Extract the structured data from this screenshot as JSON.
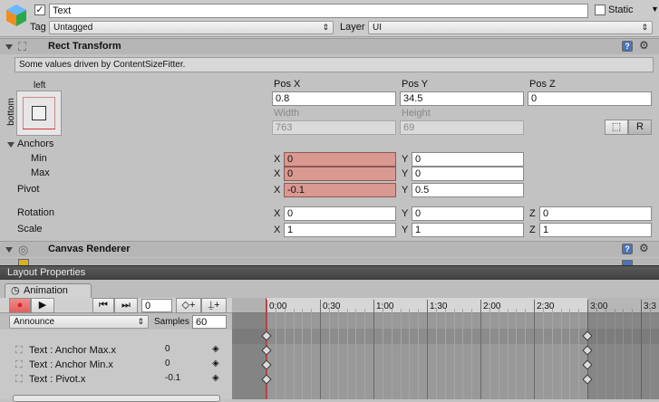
{
  "object": {
    "name": "Text",
    "active": true,
    "static_label": "Static",
    "static_checked": false,
    "tag_label": "Tag",
    "tag_value": "Untagged",
    "layer_label": "Layer",
    "layer_value": "UI"
  },
  "rect_transform": {
    "title": "Rect Transform",
    "info": "Some values driven by ContentSizeFitter.",
    "anchor_preset_top": "left",
    "anchor_preset_side": "bottom",
    "col_headers": [
      "Pos X",
      "Pos Y",
      "Pos Z"
    ],
    "pos_x": "0.8",
    "pos_y": "34.5",
    "pos_z": "0",
    "width_label": "Width",
    "height_label": "Height",
    "width": "763",
    "height": "69",
    "blueprint_r": "R",
    "anchors_label": "Anchors",
    "min_label": "Min",
    "max_label": "Max",
    "pivot_label": "Pivot",
    "rotation_label": "Rotation",
    "scale_label": "Scale",
    "x_label": "X",
    "y_label": "Y",
    "z_label": "Z",
    "anchor_min": {
      "x": "0",
      "y": "0"
    },
    "anchor_max": {
      "x": "0",
      "y": "0"
    },
    "pivot": {
      "x": "-0.1",
      "y": "0.5"
    },
    "rotation": {
      "x": "0",
      "y": "0",
      "z": "0"
    },
    "scale": {
      "x": "1",
      "y": "1",
      "z": "1"
    }
  },
  "canvas_renderer": {
    "title": "Canvas Renderer"
  },
  "layout_properties": {
    "title": "Layout Properties"
  },
  "animation": {
    "tab_label": "Animation",
    "frame": "0",
    "clip": "Announce",
    "samples_label": "Samples",
    "samples": "60",
    "timeline_labels": [
      "0:00",
      "0:30",
      "1:00",
      "1:30",
      "2:00",
      "2:30",
      "3:00",
      "3:3"
    ],
    "tracks": [
      {
        "name": "Text : Anchor Max.x",
        "value": "0"
      },
      {
        "name": "Text : Anchor Min.x",
        "value": "0"
      },
      {
        "name": "Text : Pivot.x",
        "value": "-0.1"
      }
    ]
  },
  "colors": {
    "driven_field": "#d99890",
    "playhead": "#ff2020",
    "record": "#e02020"
  }
}
